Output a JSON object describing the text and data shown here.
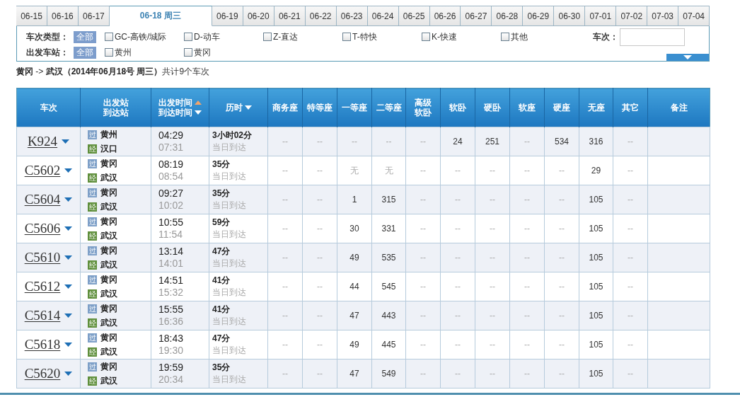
{
  "date_tabs": [
    {
      "label": "06-15",
      "selected": false
    },
    {
      "label": "06-16",
      "selected": false
    },
    {
      "label": "06-17",
      "selected": false
    },
    {
      "label": "06-18 周三",
      "selected": true
    },
    {
      "label": "06-19",
      "selected": false
    },
    {
      "label": "06-20",
      "selected": false
    },
    {
      "label": "06-21",
      "selected": false
    },
    {
      "label": "06-22",
      "selected": false
    },
    {
      "label": "06-23",
      "selected": false
    },
    {
      "label": "06-24",
      "selected": false
    },
    {
      "label": "06-25",
      "selected": false
    },
    {
      "label": "06-26",
      "selected": false
    },
    {
      "label": "06-27",
      "selected": false
    },
    {
      "label": "06-28",
      "selected": false
    },
    {
      "label": "06-29",
      "selected": false
    },
    {
      "label": "06-30",
      "selected": false
    },
    {
      "label": "07-01",
      "selected": false
    },
    {
      "label": "07-02",
      "selected": false
    },
    {
      "label": "07-03",
      "selected": false
    },
    {
      "label": "07-04",
      "selected": false
    }
  ],
  "filters": {
    "groups": [
      {
        "label": "车次类型：",
        "all_button": {
          "label": "全部",
          "selected": true
        },
        "options": [
          {
            "label": "GC-高铁/城际",
            "checked": false
          },
          {
            "label": "D-动车",
            "checked": false
          },
          {
            "label": "Z-直达",
            "checked": false
          },
          {
            "label": "T-特快",
            "checked": false
          },
          {
            "label": "K-快速",
            "checked": false
          },
          {
            "label": "其他",
            "checked": false
          }
        ]
      },
      {
        "label": "出发车站：",
        "all_button": {
          "label": "全部",
          "selected": true
        },
        "options": [
          {
            "label": "黄州",
            "checked": false
          },
          {
            "label": "黄冈",
            "checked": false
          }
        ]
      }
    ],
    "train_search": {
      "label": "车次："
    }
  },
  "summary": "**黄冈** -> **武汉（2014年06月18号  周三）**共计9个车次",
  "table": {
    "columns": [
      {
        "lines": [
          {
            "text": "车次"
          }
        ]
      },
      {
        "lines": [
          {
            "text": "出发站"
          },
          {
            "text": "到达站"
          }
        ]
      },
      {
        "lines": [
          {
            "text": "出发时间",
            "sort_ascending": true
          },
          {
            "text": "到达时间",
            "sort_ascending": false
          }
        ]
      },
      {
        "lines": [
          {
            "text": "历时",
            "sort_ascending": false
          }
        ]
      },
      {
        "lines": [
          {
            "text": "商务座"
          }
        ]
      },
      {
        "lines": [
          {
            "text": "特等座"
          }
        ]
      },
      {
        "lines": [
          {
            "text": "一等座"
          }
        ]
      },
      {
        "lines": [
          {
            "text": "二等座"
          }
        ]
      },
      {
        "lines": [
          {
            "text": "高级"
          },
          {
            "text": "软卧"
          }
        ]
      },
      {
        "lines": [
          {
            "text": "软卧"
          }
        ]
      },
      {
        "lines": [
          {
            "text": "硬卧"
          }
        ]
      },
      {
        "lines": [
          {
            "text": "软座"
          }
        ]
      },
      {
        "lines": [
          {
            "text": "硬座"
          }
        ]
      },
      {
        "lines": [
          {
            "text": "无座"
          }
        ]
      },
      {
        "lines": [
          {
            "text": "其它"
          }
        ]
      },
      {
        "lines": [
          {
            "text": "备注"
          }
        ]
      }
    ],
    "rows": [
      {
        "train": "K924",
        "from_badge": "过",
        "from": "黄州",
        "to_badge": "经",
        "to": "汉口",
        "depart": "04:29",
        "arrive": "07:31",
        "duration": "3小时02分",
        "arrival_day": "当日到达",
        "seats": [
          {
            "value": "--",
            "available": false
          },
          {
            "value": "--",
            "available": false
          },
          {
            "value": "--",
            "available": false
          },
          {
            "value": "--",
            "available": false
          },
          {
            "value": "--",
            "available": false
          },
          {
            "value": "24",
            "available": true
          },
          {
            "value": "251",
            "available": true
          },
          {
            "value": "--",
            "available": false
          },
          {
            "value": "534",
            "available": true
          },
          {
            "value": "316",
            "available": true
          },
          {
            "value": "--",
            "available": false
          }
        ]
      },
      {
        "train": "C5602",
        "from_badge": "过",
        "from": "黄冈",
        "to_badge": "经",
        "to": "武汉",
        "depart": "08:19",
        "arrive": "08:54",
        "duration": "35分",
        "arrival_day": "当日到达",
        "seats": [
          {
            "value": "--",
            "available": false
          },
          {
            "value": "--",
            "available": false
          },
          {
            "value": "无",
            "available": false
          },
          {
            "value": "无",
            "available": false
          },
          {
            "value": "--",
            "available": false
          },
          {
            "value": "--",
            "available": false
          },
          {
            "value": "--",
            "available": false
          },
          {
            "value": "--",
            "available": false
          },
          {
            "value": "--",
            "available": false
          },
          {
            "value": "29",
            "available": true
          },
          {
            "value": "--",
            "available": false
          }
        ]
      },
      {
        "train": "C5604",
        "from_badge": "过",
        "from": "黄冈",
        "to_badge": "经",
        "to": "武汉",
        "depart": "09:27",
        "arrive": "10:02",
        "duration": "35分",
        "arrival_day": "当日到达",
        "seats": [
          {
            "value": "--",
            "available": false
          },
          {
            "value": "--",
            "available": false
          },
          {
            "value": "1",
            "available": true
          },
          {
            "value": "315",
            "available": true
          },
          {
            "value": "--",
            "available": false
          },
          {
            "value": "--",
            "available": false
          },
          {
            "value": "--",
            "available": false
          },
          {
            "value": "--",
            "available": false
          },
          {
            "value": "--",
            "available": false
          },
          {
            "value": "105",
            "available": true
          },
          {
            "value": "--",
            "available": false
          }
        ]
      },
      {
        "train": "C5606",
        "from_badge": "过",
        "from": "黄冈",
        "to_badge": "经",
        "to": "武汉",
        "depart": "10:55",
        "arrive": "11:54",
        "duration": "59分",
        "arrival_day": "当日到达",
        "seats": [
          {
            "value": "--",
            "available": false
          },
          {
            "value": "--",
            "available": false
          },
          {
            "value": "30",
            "available": true
          },
          {
            "value": "331",
            "available": true
          },
          {
            "value": "--",
            "available": false
          },
          {
            "value": "--",
            "available": false
          },
          {
            "value": "--",
            "available": false
          },
          {
            "value": "--",
            "available": false
          },
          {
            "value": "--",
            "available": false
          },
          {
            "value": "105",
            "available": true
          },
          {
            "value": "--",
            "available": false
          }
        ]
      },
      {
        "train": "C5610",
        "from_badge": "过",
        "from": "黄冈",
        "to_badge": "经",
        "to": "武汉",
        "depart": "13:14",
        "arrive": "14:01",
        "duration": "47分",
        "arrival_day": "当日到达",
        "seats": [
          {
            "value": "--",
            "available": false
          },
          {
            "value": "--",
            "available": false
          },
          {
            "value": "49",
            "available": true
          },
          {
            "value": "535",
            "available": true
          },
          {
            "value": "--",
            "available": false
          },
          {
            "value": "--",
            "available": false
          },
          {
            "value": "--",
            "available": false
          },
          {
            "value": "--",
            "available": false
          },
          {
            "value": "--",
            "available": false
          },
          {
            "value": "105",
            "available": true
          },
          {
            "value": "--",
            "available": false
          }
        ]
      },
      {
        "train": "C5612",
        "from_badge": "过",
        "from": "黄冈",
        "to_badge": "经",
        "to": "武汉",
        "depart": "14:51",
        "arrive": "15:32",
        "duration": "41分",
        "arrival_day": "当日到达",
        "seats": [
          {
            "value": "--",
            "available": false
          },
          {
            "value": "--",
            "available": false
          },
          {
            "value": "44",
            "available": true
          },
          {
            "value": "545",
            "available": true
          },
          {
            "value": "--",
            "available": false
          },
          {
            "value": "--",
            "available": false
          },
          {
            "value": "--",
            "available": false
          },
          {
            "value": "--",
            "available": false
          },
          {
            "value": "--",
            "available": false
          },
          {
            "value": "105",
            "available": true
          },
          {
            "value": "--",
            "available": false
          }
        ]
      },
      {
        "train": "C5614",
        "from_badge": "过",
        "from": "黄冈",
        "to_badge": "经",
        "to": "武汉",
        "depart": "15:55",
        "arrive": "16:36",
        "duration": "41分",
        "arrival_day": "当日到达",
        "seats": [
          {
            "value": "--",
            "available": false
          },
          {
            "value": "--",
            "available": false
          },
          {
            "value": "47",
            "available": true
          },
          {
            "value": "443",
            "available": true
          },
          {
            "value": "--",
            "available": false
          },
          {
            "value": "--",
            "available": false
          },
          {
            "value": "--",
            "available": false
          },
          {
            "value": "--",
            "available": false
          },
          {
            "value": "--",
            "available": false
          },
          {
            "value": "105",
            "available": true
          },
          {
            "value": "--",
            "available": false
          }
        ]
      },
      {
        "train": "C5618",
        "from_badge": "过",
        "from": "黄冈",
        "to_badge": "经",
        "to": "武汉",
        "depart": "18:43",
        "arrive": "19:30",
        "duration": "47分",
        "arrival_day": "当日到达",
        "seats": [
          {
            "value": "--",
            "available": false
          },
          {
            "value": "--",
            "available": false
          },
          {
            "value": "49",
            "available": true
          },
          {
            "value": "445",
            "available": true
          },
          {
            "value": "--",
            "available": false
          },
          {
            "value": "--",
            "available": false
          },
          {
            "value": "--",
            "available": false
          },
          {
            "value": "--",
            "available": false
          },
          {
            "value": "--",
            "available": false
          },
          {
            "value": "105",
            "available": true
          },
          {
            "value": "--",
            "available": false
          }
        ]
      },
      {
        "train": "C5620",
        "from_badge": "过",
        "from": "黄冈",
        "to_badge": "经",
        "to": "武汉",
        "depart": "19:59",
        "arrive": "20:34",
        "duration": "35分",
        "arrival_day": "当日到达",
        "seats": [
          {
            "value": "--",
            "available": false
          },
          {
            "value": "--",
            "available": false
          },
          {
            "value": "47",
            "available": true
          },
          {
            "value": "549",
            "available": true
          },
          {
            "value": "--",
            "available": false
          },
          {
            "value": "--",
            "available": false
          },
          {
            "value": "--",
            "available": false
          },
          {
            "value": "--",
            "available": false
          },
          {
            "value": "--",
            "available": false
          },
          {
            "value": "105",
            "available": true
          },
          {
            "value": "--",
            "available": false
          }
        ]
      }
    ]
  }
}
